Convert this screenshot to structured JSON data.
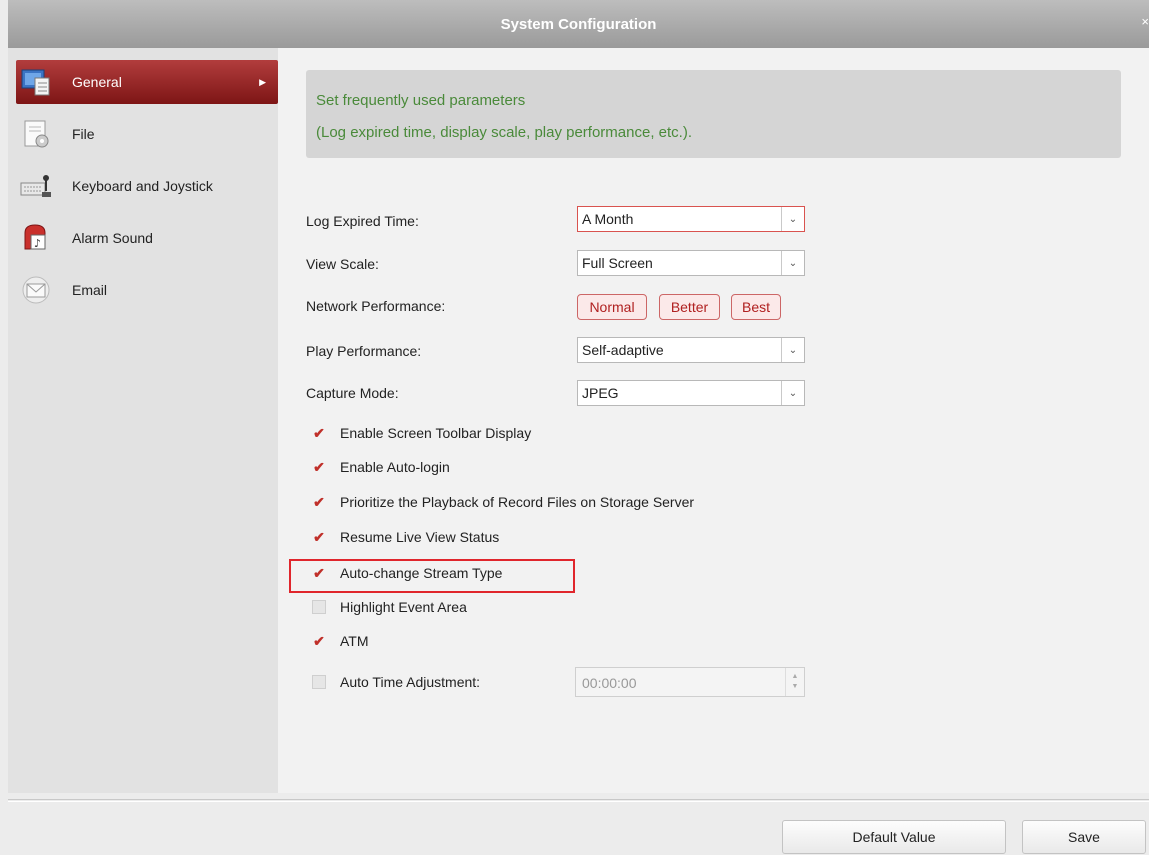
{
  "window": {
    "title": "System Configuration",
    "close_glyph": "×"
  },
  "sidebar": {
    "items": [
      {
        "label": "General",
        "icon": "monitor-icon",
        "active": true
      },
      {
        "label": "File",
        "icon": "file-gear-icon"
      },
      {
        "label": "Keyboard and Joystick",
        "icon": "keyboard-joystick-icon"
      },
      {
        "label": "Alarm Sound",
        "icon": "alarm-sound-icon"
      },
      {
        "label": "Email",
        "icon": "envelope-icon"
      }
    ]
  },
  "description": {
    "line1": "Set frequently used parameters",
    "line2": "(Log expired time, display scale, play performance, etc.)."
  },
  "form": {
    "log_expired_time": {
      "label": "Log Expired Time:",
      "value": "A Month"
    },
    "view_scale": {
      "label": "View Scale:",
      "value": "Full Screen"
    },
    "network_performance": {
      "label": "Network Performance:",
      "options": [
        "Normal",
        "Better",
        "Best"
      ]
    },
    "play_performance": {
      "label": "Play Performance:",
      "value": "Self-adaptive"
    },
    "capture_mode": {
      "label": "Capture Mode:",
      "value": "JPEG"
    }
  },
  "checkboxes": [
    {
      "label": "Enable Screen Toolbar Display",
      "checked": true
    },
    {
      "label": "Enable Auto-login",
      "checked": true
    },
    {
      "label": "Prioritize the Playback of Record Files on Storage Server",
      "checked": true
    },
    {
      "label": "Resume Live View Status",
      "checked": true
    },
    {
      "label": "Auto-change Stream Type",
      "checked": true
    },
    {
      "label": "Highlight Event Area",
      "checked": false
    },
    {
      "label": "ATM",
      "checked": true
    },
    {
      "label": "Auto Time Adjustment:",
      "checked": false
    }
  ],
  "auto_time": {
    "value": "00:00:00"
  },
  "footer": {
    "default_label": "Default Value",
    "save_label": "Save"
  },
  "colors": {
    "accent": "#9b2a2a",
    "check": "#c0302a",
    "desc_text": "#4a8a3a",
    "highlight": "#e0262c"
  }
}
